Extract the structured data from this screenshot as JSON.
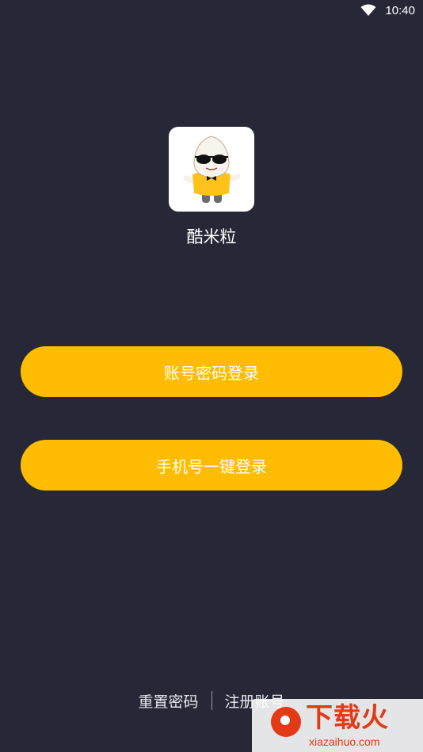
{
  "status_bar": {
    "time": "10:40",
    "wifi_icon": "wifi-icon"
  },
  "app": {
    "name": "酷米粒",
    "icon": "rice-mascot-logo"
  },
  "buttons": {
    "account_login": "账号密码登录",
    "phone_login": "手机号一键登录"
  },
  "footer": {
    "reset_password": "重置密码",
    "register": "注册账号"
  },
  "watermark": {
    "title": "下载火",
    "url": "xiazaihuo.com"
  },
  "colors": {
    "background": "#262837",
    "accent": "#ffbc00",
    "text": "#ffffff"
  }
}
